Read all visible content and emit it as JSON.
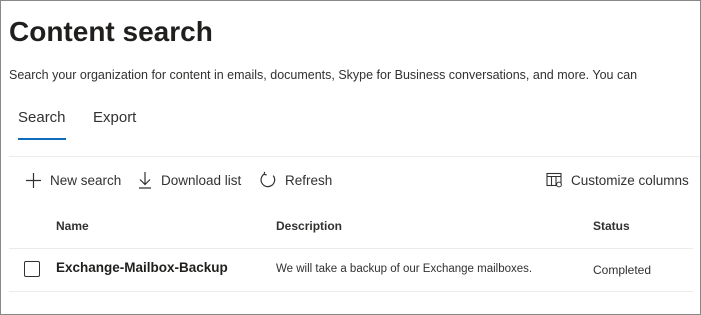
{
  "header": {
    "title": "Content search",
    "description": "Search your organization for content in emails, documents, Skype for Business conversations, and more. You can"
  },
  "tabs": [
    {
      "label": "Search",
      "selected": true
    },
    {
      "label": "Export",
      "selected": false
    }
  ],
  "commands": {
    "new_search": {
      "label": "New search",
      "icon": "plus-icon"
    },
    "download_list": {
      "label": "Download list",
      "icon": "download-icon"
    },
    "refresh": {
      "label": "Refresh",
      "icon": "refresh-icon"
    },
    "customize_columns": {
      "label": "Customize columns",
      "icon": "columns-icon"
    }
  },
  "table": {
    "columns": [
      "Name",
      "Description",
      "Status"
    ],
    "rows": [
      {
        "name": "Exchange-Mailbox-Backup",
        "description": "We will take a backup of our Exchange mailboxes.",
        "status": "Completed",
        "checked": false
      }
    ]
  },
  "colors": {
    "accent": "#0f6cbd",
    "text": "#323130",
    "divider": "#edebe9"
  }
}
